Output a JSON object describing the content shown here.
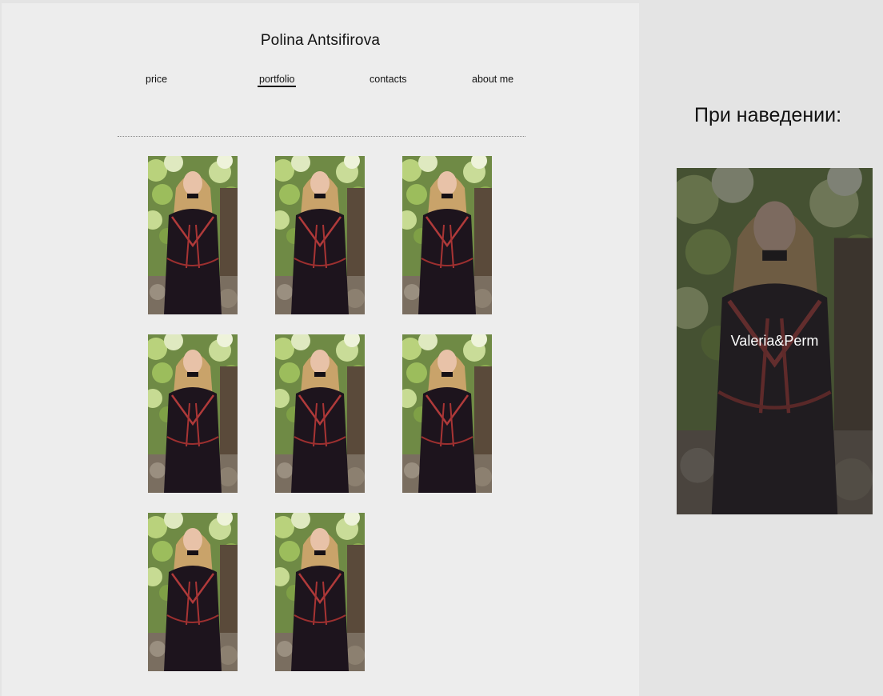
{
  "site": {
    "title": "Polina Antsifirova"
  },
  "nav": {
    "items": [
      {
        "label": "price"
      },
      {
        "label": "portfolio",
        "active": true
      },
      {
        "label": "contacts"
      },
      {
        "label": "about me"
      }
    ]
  },
  "portfolio": {
    "image_description": "portrait of a blonde woman in a black dress with red trim, forest background",
    "count": 8
  },
  "hover_demo": {
    "caption": "При наведении:",
    "label": "Valeria&Perm",
    "overlay_color": "#232323"
  }
}
